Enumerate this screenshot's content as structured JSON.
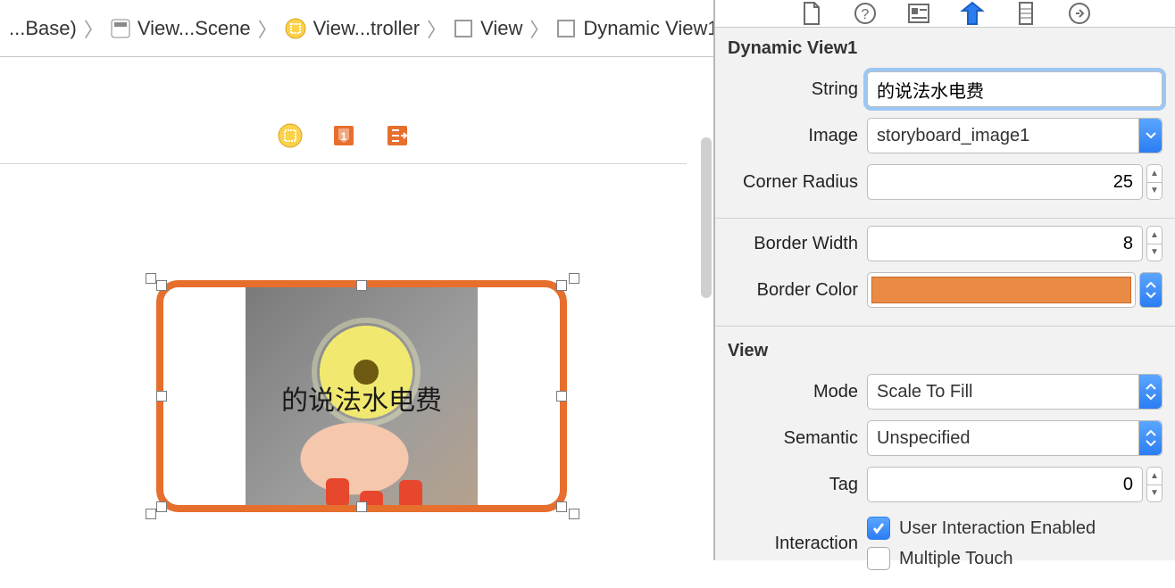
{
  "breadcrumb": {
    "items": [
      {
        "icon": "storyboard",
        "label": "...Base)"
      },
      {
        "icon": "scene",
        "label": "View...Scene"
      },
      {
        "icon": "vc",
        "label": "View...troller"
      },
      {
        "icon": "view",
        "label": "View"
      },
      {
        "icon": "view",
        "label": "Dynamic View1"
      }
    ]
  },
  "canvas": {
    "dynamic_view": {
      "text": "的说法水电费",
      "corner_radius": 25,
      "border_width": 8,
      "border_color": "#e76f2e"
    }
  },
  "inspector": {
    "tabs": [
      "file",
      "quick-help",
      "identity",
      "attributes",
      "size",
      "connections"
    ],
    "active_tab": "attributes",
    "section1_title": "Dynamic View1",
    "fields": {
      "string_label": "String",
      "string_value": "的说法水电费",
      "image_label": "Image",
      "image_value": "storyboard_image1",
      "corner_radius_label": "Corner Radius",
      "corner_radius_value": "25",
      "border_width_label": "Border Width",
      "border_width_value": "8",
      "border_color_label": "Border Color",
      "border_color_value": "#e98b45"
    },
    "section2_title": "View",
    "view_fields": {
      "mode_label": "Mode",
      "mode_value": "Scale To Fill",
      "semantic_label": "Semantic",
      "semantic_value": "Unspecified",
      "tag_label": "Tag",
      "tag_value": "0",
      "interaction_label": "Interaction",
      "user_interaction_label": "User Interaction Enabled",
      "user_interaction_checked": true,
      "multiple_touch_label": "Multiple Touch",
      "multiple_touch_checked": false
    }
  }
}
